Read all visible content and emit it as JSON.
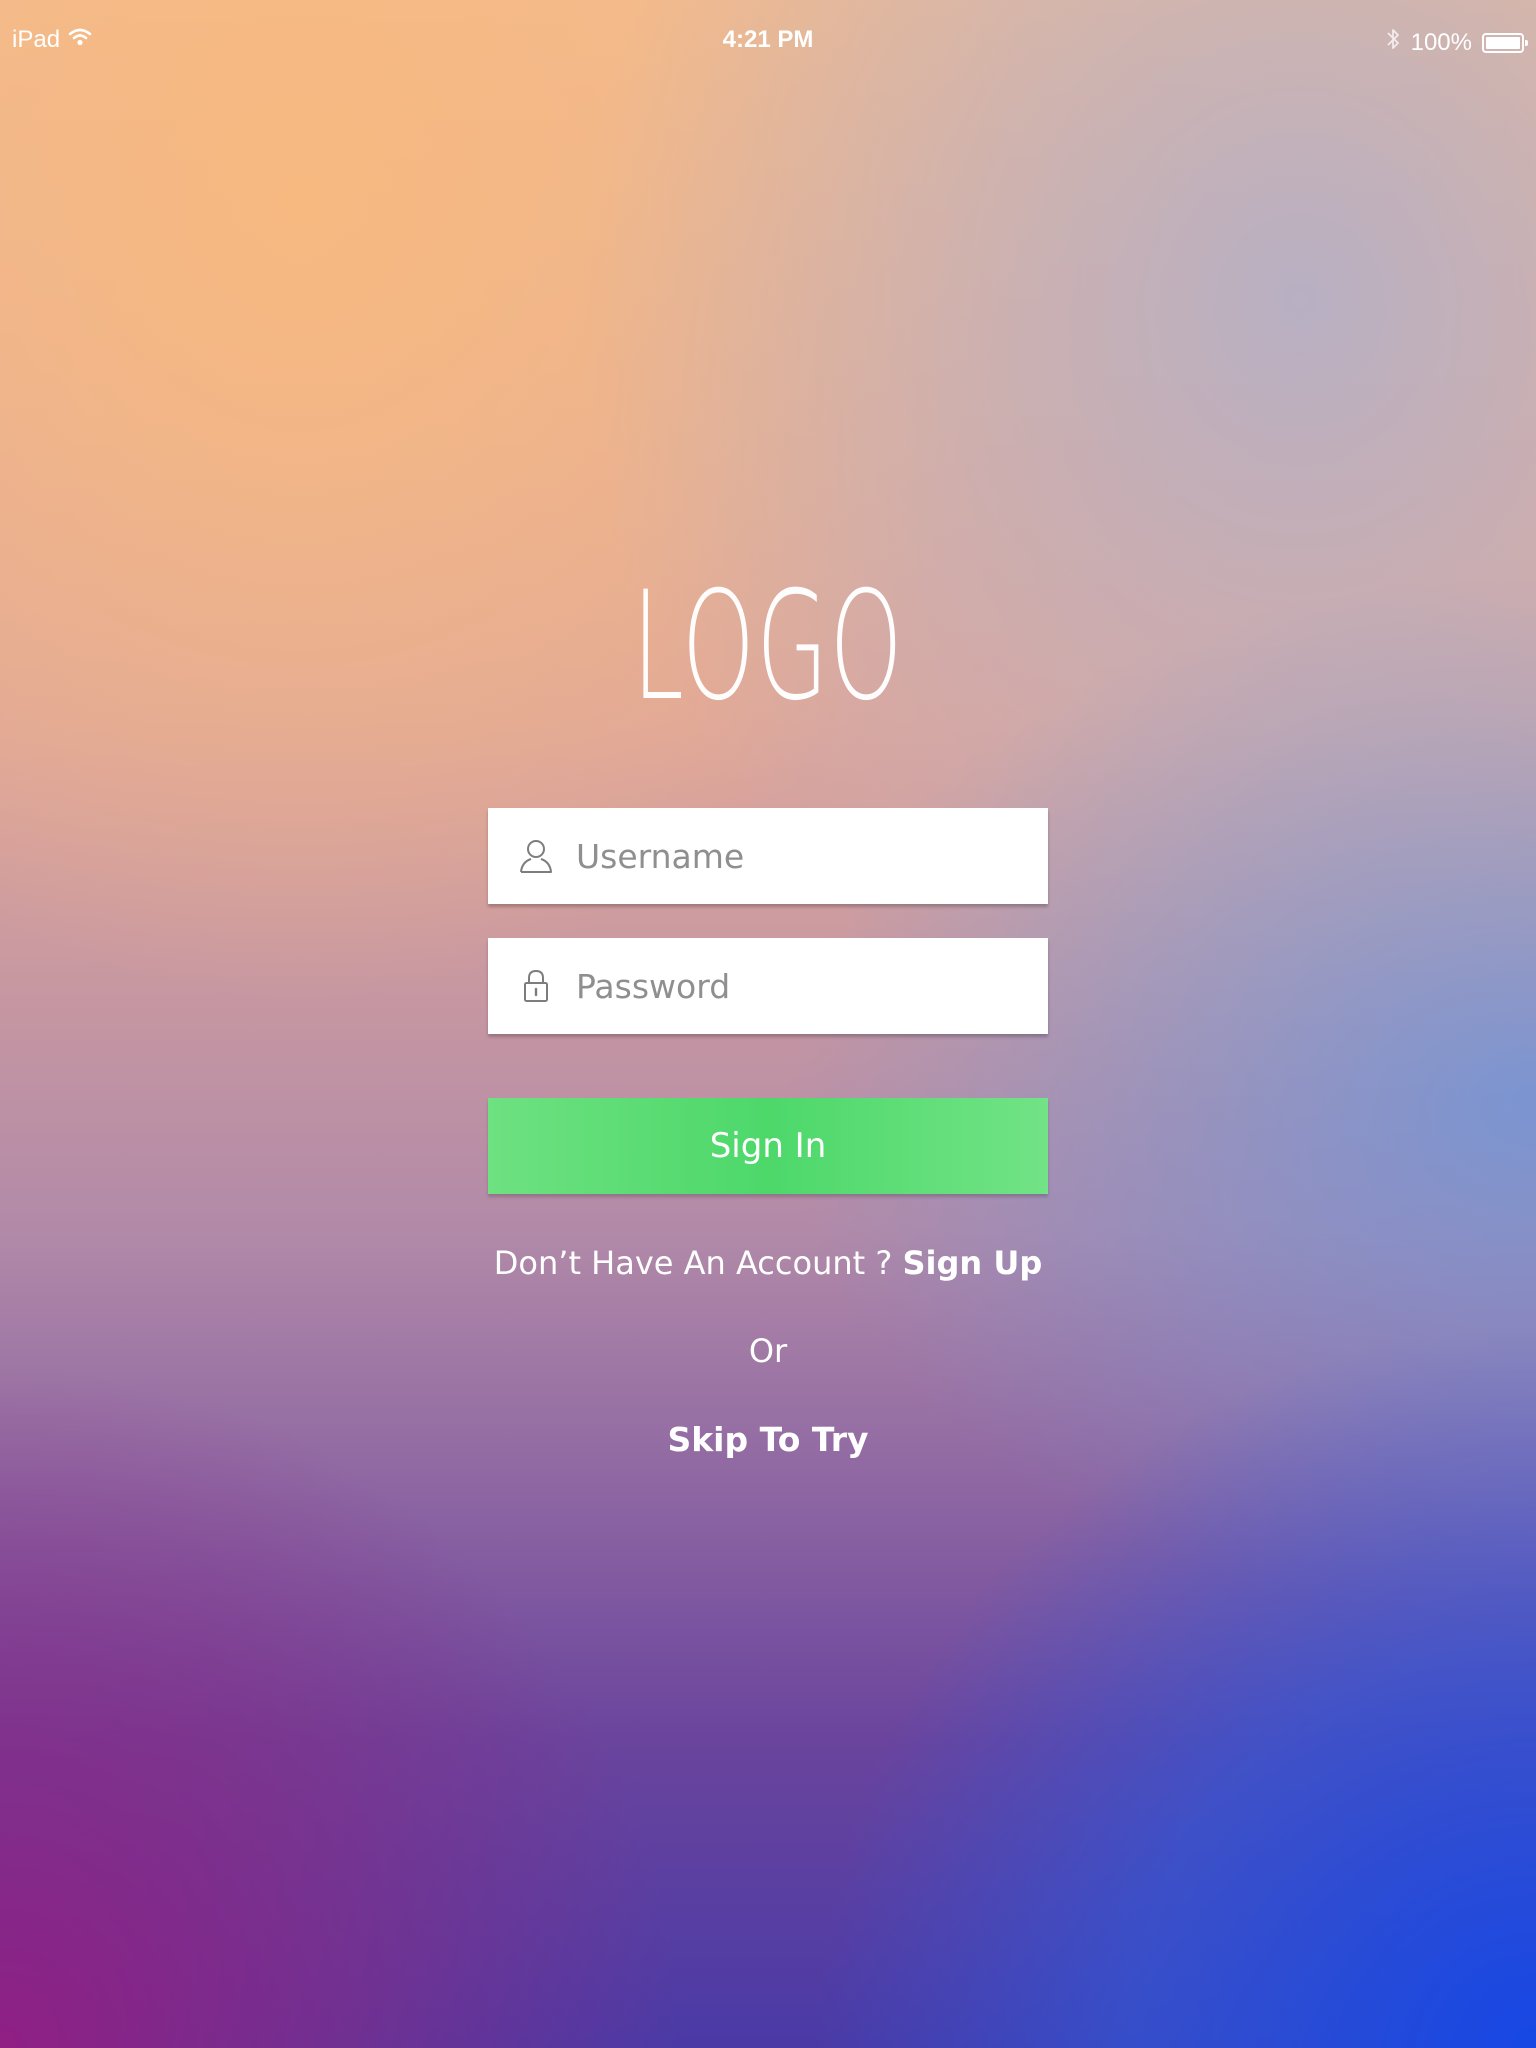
{
  "status_bar": {
    "device": "iPad",
    "time": "4:21 PM",
    "battery_percent": "100%",
    "battery_level": 1.0,
    "icons": [
      "wifi-icon",
      "bluetooth-icon",
      "battery-icon"
    ]
  },
  "logo": {
    "text": "LOGO"
  },
  "form": {
    "username": {
      "placeholder": "Username",
      "value": "",
      "icon": "user-icon"
    },
    "password": {
      "placeholder": "Password",
      "value": "",
      "icon": "lock-icon"
    },
    "sign_in_label": "Sign In"
  },
  "signup": {
    "prompt": "Don’t Have An Account ? ",
    "link_label": "Sign Up"
  },
  "or_label": "Or",
  "skip_label": "Skip To Try",
  "colors": {
    "primary_button": "#4dd86a",
    "field_background": "#ffffff",
    "placeholder_text": "#8f8f8f",
    "text_on_background": "#ffffff"
  }
}
